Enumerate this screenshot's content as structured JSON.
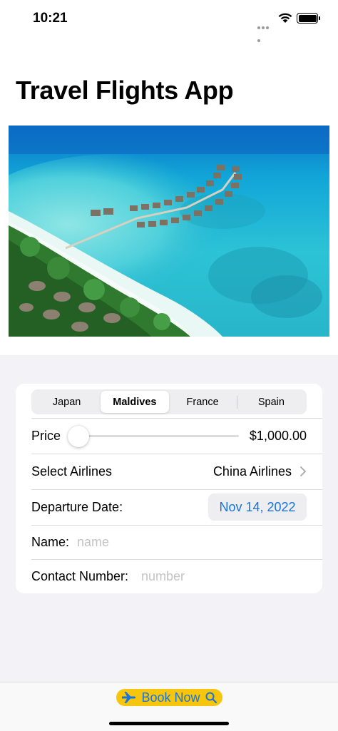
{
  "status_bar": {
    "time": "10:21"
  },
  "app": {
    "title": "Travel Flights App"
  },
  "destinations": {
    "options": [
      "Japan",
      "Maldives",
      "France",
      "Spain"
    ],
    "selected": "Maldives"
  },
  "price": {
    "label": "Price",
    "value": "$1,000.00",
    "slider_fraction": 0.0
  },
  "airlines": {
    "label": "Select Airlines",
    "value": "China Airlines"
  },
  "departure": {
    "label": "Departure Date:",
    "value": "Nov 14, 2022"
  },
  "name": {
    "label": "Name:",
    "placeholder": "name"
  },
  "contact": {
    "label": "Contact Number:",
    "placeholder": "number"
  },
  "book_button": {
    "label": "Book Now"
  },
  "colors": {
    "accent": "#1a73d9",
    "button_bg": "#f7c60c",
    "form_bg": "#f2f2f7"
  }
}
